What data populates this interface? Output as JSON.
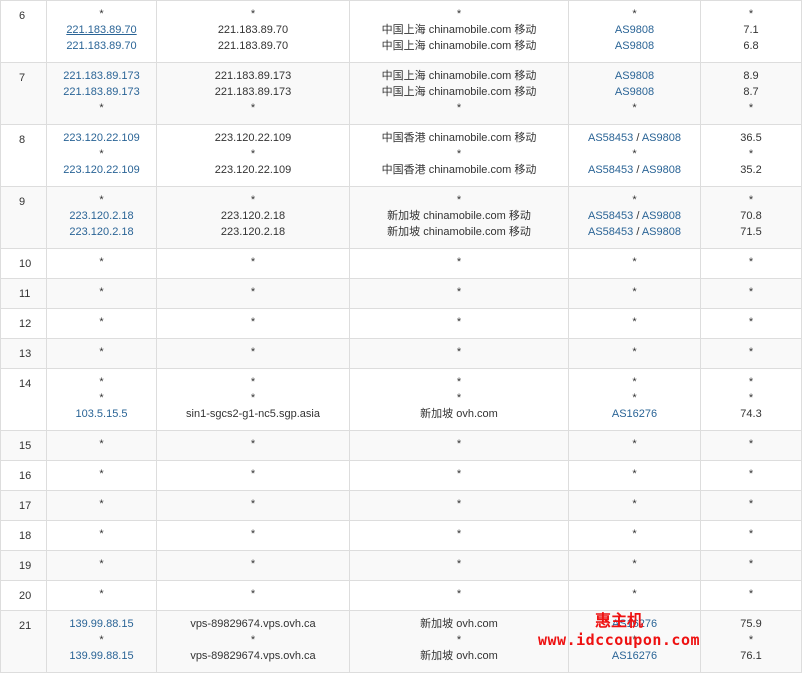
{
  "rows": [
    {
      "hop": "6",
      "bg": "even",
      "h": 62,
      "lines": [
        [
          "*",
          "*",
          "*",
          "*",
          "*"
        ],
        [
          "221.183.89.70",
          "221.183.89.70",
          "中国上海 chinamobile.com 移动",
          [
            "AS9808"
          ],
          "7.1"
        ],
        [
          "221.183.89.70",
          "221.183.89.70",
          "中国上海 chinamobile.com 移动",
          [
            "AS9808"
          ],
          "6.8"
        ]
      ]
    },
    {
      "hop": "7",
      "bg": "odd",
      "h": 62,
      "lines": [
        [
          "221.183.89.173",
          "221.183.89.173",
          "中国上海 chinamobile.com 移动",
          [
            "AS9808"
          ],
          "8.9"
        ],
        [
          "221.183.89.173",
          "221.183.89.173",
          "中国上海 chinamobile.com 移动",
          [
            "AS9808"
          ],
          "8.7"
        ],
        [
          "*",
          "*",
          "*",
          "*",
          "*"
        ]
      ]
    },
    {
      "hop": "8",
      "bg": "even",
      "h": 62,
      "lines": [
        [
          "223.120.22.109",
          "223.120.22.109",
          "中国香港 chinamobile.com 移动",
          [
            "AS58453",
            "AS9808"
          ],
          "36.5"
        ],
        [
          "*",
          "*",
          "*",
          "*",
          "*"
        ],
        [
          "223.120.22.109",
          "223.120.22.109",
          "中国香港 chinamobile.com 移动",
          [
            "AS58453",
            "AS9808"
          ],
          "35.2"
        ]
      ]
    },
    {
      "hop": "9",
      "bg": "odd",
      "h": 62,
      "lines": [
        [
          "*",
          "*",
          "*",
          "*",
          "*"
        ],
        [
          "223.120.2.18",
          "223.120.2.18",
          "新加坡 chinamobile.com 移动",
          [
            "AS58453",
            "AS9808"
          ],
          "70.8"
        ],
        [
          "223.120.2.18",
          "223.120.2.18",
          "新加坡 chinamobile.com 移动",
          [
            "AS58453",
            "AS9808"
          ],
          "71.5"
        ]
      ]
    },
    {
      "hop": "10",
      "bg": "even",
      "h": 30,
      "lines": [
        [
          "*",
          "*",
          "*",
          "*",
          "*"
        ]
      ]
    },
    {
      "hop": "11",
      "bg": "odd",
      "h": 30,
      "lines": [
        [
          "*",
          "*",
          "*",
          "*",
          "*"
        ]
      ]
    },
    {
      "hop": "12",
      "bg": "even",
      "h": 30,
      "lines": [
        [
          "*",
          "*",
          "*",
          "*",
          "*"
        ]
      ]
    },
    {
      "hop": "13",
      "bg": "odd",
      "h": 30,
      "lines": [
        [
          "*",
          "*",
          "*",
          "*",
          "*"
        ]
      ]
    },
    {
      "hop": "14",
      "bg": "even",
      "h": 62,
      "lines": [
        [
          "*",
          "*",
          "*",
          "*",
          "*"
        ],
        [
          "*",
          "*",
          "*",
          "*",
          "*"
        ],
        [
          "103.5.15.5",
          "sin1-sgcs2-g1-nc5.sgp.asia",
          "新加坡 ovh.com",
          [
            "AS16276"
          ],
          "74.3"
        ]
      ]
    },
    {
      "hop": "15",
      "bg": "odd",
      "h": 30,
      "lines": [
        [
          "*",
          "*",
          "*",
          "*",
          "*"
        ]
      ]
    },
    {
      "hop": "16",
      "bg": "even",
      "h": 30,
      "lines": [
        [
          "*",
          "*",
          "*",
          "*",
          "*"
        ]
      ]
    },
    {
      "hop": "17",
      "bg": "odd",
      "h": 30,
      "lines": [
        [
          "*",
          "*",
          "*",
          "*",
          "*"
        ]
      ]
    },
    {
      "hop": "18",
      "bg": "even",
      "h": 30,
      "lines": [
        [
          "*",
          "*",
          "*",
          "*",
          "*"
        ]
      ]
    },
    {
      "hop": "19",
      "bg": "odd",
      "h": 30,
      "lines": [
        [
          "*",
          "*",
          "*",
          "*",
          "*"
        ]
      ]
    },
    {
      "hop": "20",
      "bg": "even",
      "h": 30,
      "lines": [
        [
          "*",
          "*",
          "*",
          "*",
          "*"
        ]
      ]
    },
    {
      "hop": "21",
      "bg": "odd",
      "h": 62,
      "lines": [
        [
          "139.99.88.15",
          "vps-89829674.vps.ovh.ca",
          "新加坡 ovh.com",
          [
            "AS16276"
          ],
          "75.9"
        ],
        [
          "*",
          "*",
          "*",
          "*",
          "*"
        ],
        [
          "139.99.88.15",
          "vps-89829674.vps.ovh.ca",
          "新加坡 ovh.com",
          [
            "AS16276"
          ],
          "76.1"
        ]
      ]
    }
  ],
  "separator": "/",
  "watermark": {
    "title": "惠主机",
    "url": "www.idccoupon.com"
  },
  "colors": {
    "link": "#2a6496",
    "border": "#dddddd",
    "stripe": "#f9f9f9",
    "watermark": "#ee1111"
  }
}
